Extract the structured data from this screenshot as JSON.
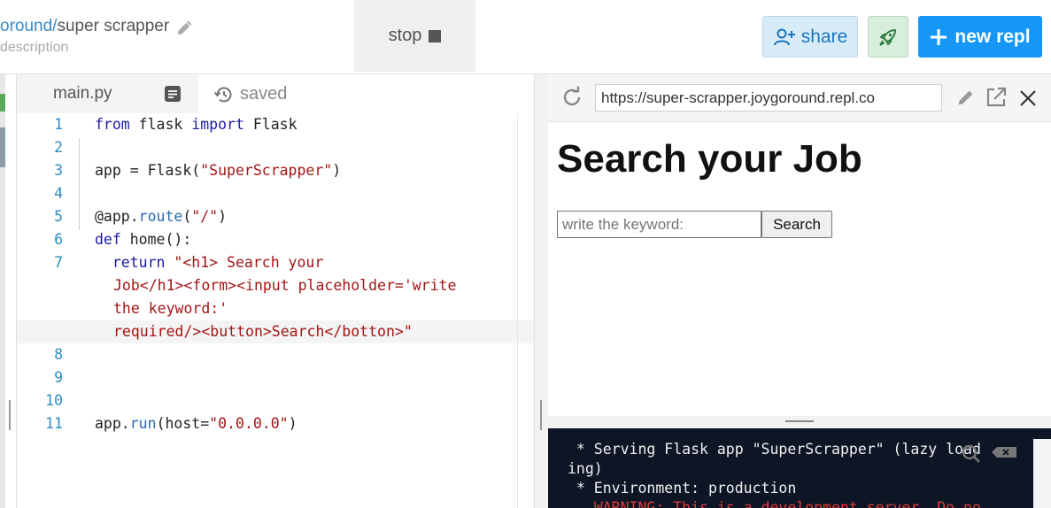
{
  "header": {
    "owner": "oround",
    "separator": "/",
    "repl_name": "super scrapper",
    "description": "description",
    "stop_label": "stop",
    "share_label": "share",
    "new_repl_label": "new repl",
    "colors": {
      "share_bg": "#d8ebf8",
      "share_text": "#1a76c3",
      "rocket_bg": "#d8eedc",
      "new_repl_bg": "#1697f6"
    }
  },
  "editor": {
    "tab_label": "main.py",
    "saved_label": "saved",
    "lines": [
      {
        "n": "1",
        "tokens": [
          {
            "t": "from",
            "c": "kw"
          },
          {
            "t": " flask ",
            "c": ""
          },
          {
            "t": "import",
            "c": "kw"
          },
          {
            "t": " Flask",
            "c": ""
          }
        ]
      },
      {
        "n": "2",
        "tokens": []
      },
      {
        "n": "3",
        "tokens": [
          {
            "t": "app = Flask(",
            "c": ""
          },
          {
            "t": "\"SuperScrapper\"",
            "c": "str"
          },
          {
            "t": ")",
            "c": ""
          }
        ]
      },
      {
        "n": "4",
        "tokens": []
      },
      {
        "n": "5",
        "tokens": [
          {
            "t": "@app.",
            "c": ""
          },
          {
            "t": "route",
            "c": "fn"
          },
          {
            "t": "(",
            "c": ""
          },
          {
            "t": "\"/\"",
            "c": "str"
          },
          {
            "t": ")",
            "c": ""
          }
        ]
      },
      {
        "n": "6",
        "tokens": [
          {
            "t": "def",
            "c": "kw"
          },
          {
            "t": " home():",
            "c": ""
          }
        ]
      },
      {
        "n": "7",
        "tokens": [
          {
            "t": "  ",
            "c": ""
          },
          {
            "t": "return",
            "c": "kw"
          },
          {
            "t": " ",
            "c": ""
          },
          {
            "t": "\"<h1> Search your",
            "c": "str"
          }
        ]
      },
      {
        "n": "",
        "cont": "Job</h1><form><input placeholder='write"
      },
      {
        "n": "",
        "cont": "the keyword:'"
      },
      {
        "n": "",
        "cont": "required/><button>Search</botton>\"",
        "highlight": true
      },
      {
        "n": "8",
        "tokens": []
      },
      {
        "n": "9",
        "tokens": []
      },
      {
        "n": "10",
        "tokens": []
      },
      {
        "n": "11",
        "tokens": [
          {
            "t": "app.",
            "c": ""
          },
          {
            "t": "run",
            "c": "fn"
          },
          {
            "t": "(host=",
            "c": ""
          },
          {
            "t": "\"0.0.0.0\"",
            "c": "str"
          },
          {
            "t": ")",
            "c": ""
          }
        ]
      }
    ]
  },
  "browser": {
    "url": "https://super-scrapper.joygoround.repl.co",
    "heading": "Search your Job",
    "input_placeholder": "write the keyword:",
    "button_label": "Search"
  },
  "console": {
    "lines": [
      {
        "text": " * Serving Flask app \"SuperScrapper\" (lazy load",
        "warn": false
      },
      {
        "text": "ing)",
        "warn": false
      },
      {
        "text": " * Environment: production",
        "warn": false
      },
      {
        "text": "   WARNING: This is a development server. Do no",
        "warn": true
      }
    ]
  }
}
